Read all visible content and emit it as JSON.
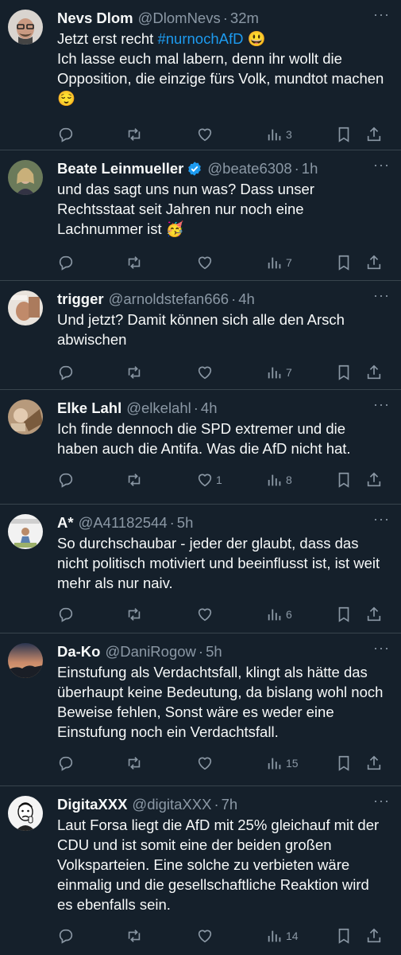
{
  "tweets": [
    {
      "name": "Nevs Dlom",
      "handle": "@DlomNevs",
      "time": "32m",
      "verified": false,
      "text_before": "Jetzt erst recht ",
      "hashtag": "#nurnochAfD",
      "text_after": " 😃\nIch lasse euch mal labern, denn ihr wollt die Opposition, die einzige fürs Volk, mundtot machen 😌",
      "likes": "",
      "views": "3"
    },
    {
      "name": "Beate Leinmueller",
      "handle": "@beate6308",
      "time": "1h",
      "verified": true,
      "text": "und das sagt uns nun was? Dass unser Rechtsstaat seit Jahren nur noch eine Lachnummer ist 🥳",
      "likes": "",
      "views": "7"
    },
    {
      "name": "trigger",
      "handle": "@arnoldstefan666",
      "time": "4h",
      "verified": false,
      "text": "Und jetzt? Damit können sich alle den Arsch abwischen",
      "likes": "",
      "views": "7"
    },
    {
      "name": "Elke Lahl",
      "handle": "@elkelahl",
      "time": "4h",
      "verified": false,
      "text": "Ich finde dennoch die SPD extremer und die haben auch die Antifa. Was die AfD nicht hat.",
      "likes": "1",
      "views": "8"
    },
    {
      "name": "A*",
      "handle": "@A41182544",
      "time": "5h",
      "verified": false,
      "text": "So durchschaubar - jeder der glaubt, dass das nicht politisch motiviert und beeinflusst ist, ist weit mehr als nur naiv.",
      "likes": "",
      "views": "6"
    },
    {
      "name": "Da-Ko",
      "handle": "@DaniRogow",
      "time": "5h",
      "verified": false,
      "text": "Einstufung als Verdachtsfall, klingt als hätte das überhaupt keine Bedeutung, da bislang wohl noch Beweise fehlen, Sonst wäre es weder eine Einstufung noch ein Verdachtsfall.",
      "likes": "",
      "views": "15"
    },
    {
      "name": "DigitaXXX",
      "handle": "@digitaXXX",
      "time": "7h",
      "verified": false,
      "text": "Laut Forsa liegt die AfD mit 25% gleichauf mit der CDU und ist somit eine der beiden großen Volksparteien. Eine solche zu verbieten wäre einmalig und die gesellschaftliche Reaktion wird es ebenfalls sein.",
      "likes": "",
      "views": "14"
    }
  ],
  "ui": {
    "separator_dot": "·",
    "more": "···"
  },
  "colors": {
    "background": "#15202b",
    "text": "#f7f9f9",
    "secondary": "#8b98a5",
    "accent": "#1d9bf0",
    "divider": "#38444d"
  },
  "icons": [
    "reply-icon",
    "retweet-icon",
    "like-icon",
    "views-icon",
    "bookmark-icon",
    "share-icon",
    "verified-icon",
    "more-icon"
  ]
}
